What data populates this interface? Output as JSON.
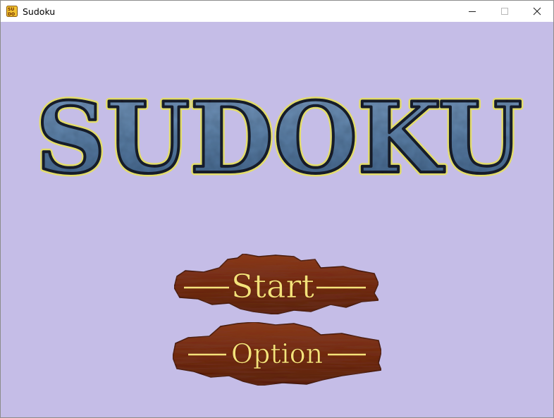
{
  "window": {
    "title": "Sudoku",
    "app_icon": "sudoku-app-icon",
    "controls": [
      "minimize-icon",
      "maximize-icon",
      "close-icon"
    ]
  },
  "logo": {
    "text": "SUDOKU",
    "fill_color": "#5b7fa6",
    "outline_color": "#1a2230",
    "glow_color": "#e3dc6a"
  },
  "menu": {
    "start_label": "Start",
    "option_label": "Option",
    "label_color": "#f4e27a",
    "wood_color": "#7a2a12"
  },
  "colors": {
    "background": "#c5bde7",
    "titlebar": "#ffffff"
  }
}
